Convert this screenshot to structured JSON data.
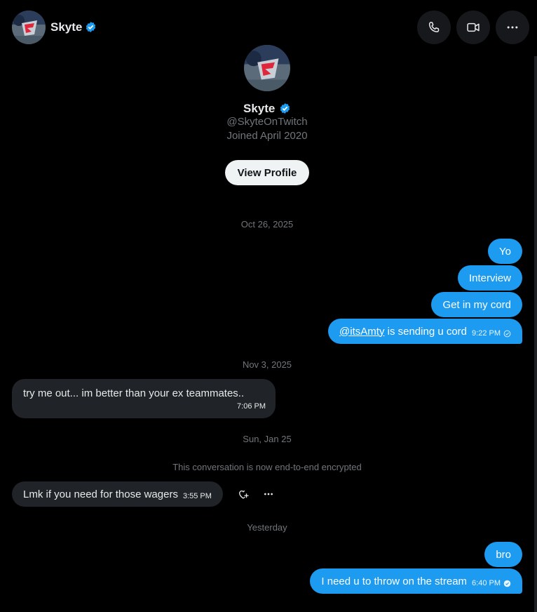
{
  "header": {
    "name": "Skyte",
    "avatar_desc": "skyte-logo-avatar",
    "verified_color": "#1d9bf0"
  },
  "profile": {
    "name": "Skyte",
    "handle": "@SkyteOnTwitch",
    "joined": "Joined April 2020",
    "view_profile_label": "View Profile"
  },
  "separators": {
    "oct": "Oct 26, 2025",
    "nov": "Nov 3, 2025",
    "jan": "Sun, Jan 25",
    "encrypted": "This conversation is now end-to-end encrypted",
    "yesterday": "Yesterday"
  },
  "messages": [
    {
      "from": "me",
      "text": "Yo"
    },
    {
      "from": "me",
      "text": "Interview"
    },
    {
      "from": "me",
      "text": "Get in my cord"
    },
    {
      "from": "me",
      "mention": "@itsAmty",
      "text": " is sending u cord",
      "time": "9:22 PM"
    },
    {
      "from": "them",
      "text": "try me out... im better than your ex teammates..",
      "time": "7:06 PM"
    },
    {
      "from": "them",
      "text": "Lmk if you need for those wagers",
      "time": "3:55 PM"
    },
    {
      "from": "me",
      "text": "bro"
    },
    {
      "from": "me",
      "text": "I need u to throw on the stream",
      "time": "6:40 PM"
    }
  ],
  "colors": {
    "accent": "#1d9bf0",
    "incoming_bubble": "#202327",
    "muted_text": "#71767b",
    "background": "#000000"
  }
}
